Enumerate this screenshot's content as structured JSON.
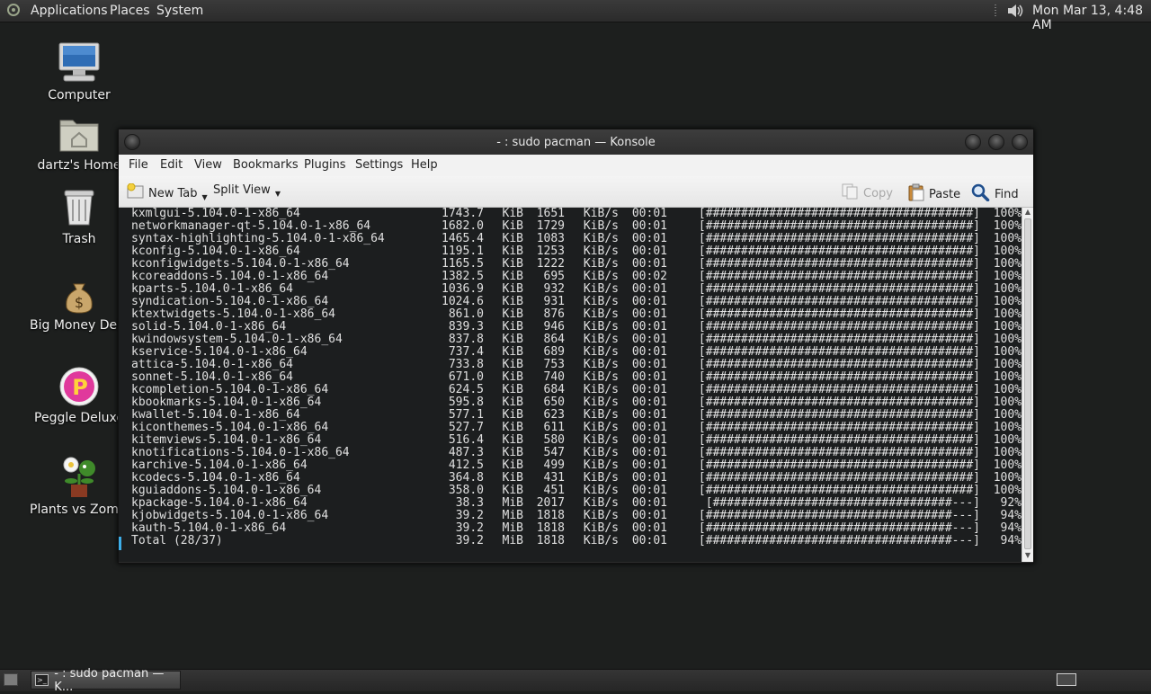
{
  "top_panel": {
    "menus": [
      "Applications",
      "Places",
      "System"
    ],
    "clock": "Mon Mar 13,  4:48 AM"
  },
  "desktop_icons": [
    {
      "label": "Computer",
      "icon": "computer-icon"
    },
    {
      "label": "dartz's Home",
      "icon": "home-folder-icon"
    },
    {
      "label": "Trash",
      "icon": "trash-icon"
    },
    {
      "label": "Big Money Delux",
      "icon": "money-bag-icon"
    },
    {
      "label": "Peggle Deluxe",
      "icon": "peggle-icon"
    },
    {
      "label": "Plants vs Zombi",
      "icon": "plants-vs-zombies-icon"
    }
  ],
  "window": {
    "title": "- : sudo pacman — Konsole",
    "menu": [
      "File",
      "Edit",
      "View",
      "Bookmarks",
      "Plugins",
      "Settings",
      "Help"
    ],
    "toolbar": {
      "new_tab": "New Tab",
      "split_view": "Split View",
      "copy": "Copy",
      "paste": "Paste",
      "find": "Find"
    }
  },
  "terminal": {
    "lines": [
      {
        "name": "kxmlgui-5.104.0-1-x86_64",
        "size": "1743.7",
        "unit": "KiB",
        "rate": "1651",
        "rate_unit": "KiB/s",
        "time": "00:01",
        "bar": "[######################################]",
        "pct": "100%"
      },
      {
        "name": "networkmanager-qt-5.104.0-1-x86_64",
        "size": "1682.0",
        "unit": "KiB",
        "rate": "1729",
        "rate_unit": "KiB/s",
        "time": "00:01",
        "bar": "[######################################]",
        "pct": "100%"
      },
      {
        "name": "syntax-highlighting-5.104.0-1-x86_64",
        "size": "1465.4",
        "unit": "KiB",
        "rate": "1083",
        "rate_unit": "KiB/s",
        "time": "00:01",
        "bar": "[######################################]",
        "pct": "100%"
      },
      {
        "name": "kconfig-5.104.0-1-x86_64",
        "size": "1195.1",
        "unit": "KiB",
        "rate": "1253",
        "rate_unit": "KiB/s",
        "time": "00:01",
        "bar": "[######################################]",
        "pct": "100%"
      },
      {
        "name": "kconfigwidgets-5.104.0-1-x86_64",
        "size": "1165.5",
        "unit": "KiB",
        "rate": "1222",
        "rate_unit": "KiB/s",
        "time": "00:01",
        "bar": "[######################################]",
        "pct": "100%"
      },
      {
        "name": "kcoreaddons-5.104.0-1-x86_64",
        "size": "1382.5",
        "unit": "KiB",
        "rate": "695",
        "rate_unit": "KiB/s",
        "time": "00:02",
        "bar": "[######################################]",
        "pct": "100%"
      },
      {
        "name": "kparts-5.104.0-1-x86_64",
        "size": "1036.9",
        "unit": "KiB",
        "rate": "932",
        "rate_unit": "KiB/s",
        "time": "00:01",
        "bar": "[######################################]",
        "pct": "100%"
      },
      {
        "name": "syndication-5.104.0-1-x86_64",
        "size": "1024.6",
        "unit": "KiB",
        "rate": "931",
        "rate_unit": "KiB/s",
        "time": "00:01",
        "bar": "[######################################]",
        "pct": "100%"
      },
      {
        "name": "ktextwidgets-5.104.0-1-x86_64",
        "size": "861.0",
        "unit": "KiB",
        "rate": "876",
        "rate_unit": "KiB/s",
        "time": "00:01",
        "bar": "[######################################]",
        "pct": "100%"
      },
      {
        "name": "solid-5.104.0-1-x86_64",
        "size": "839.3",
        "unit": "KiB",
        "rate": "946",
        "rate_unit": "KiB/s",
        "time": "00:01",
        "bar": "[######################################]",
        "pct": "100%"
      },
      {
        "name": "kwindowsystem-5.104.0-1-x86_64",
        "size": "837.8",
        "unit": "KiB",
        "rate": "864",
        "rate_unit": "KiB/s",
        "time": "00:01",
        "bar": "[######################################]",
        "pct": "100%"
      },
      {
        "name": "kservice-5.104.0-1-x86_64",
        "size": "737.4",
        "unit": "KiB",
        "rate": "689",
        "rate_unit": "KiB/s",
        "time": "00:01",
        "bar": "[######################################]",
        "pct": "100%"
      },
      {
        "name": "attica-5.104.0-1-x86_64",
        "size": "733.8",
        "unit": "KiB",
        "rate": "753",
        "rate_unit": "KiB/s",
        "time": "00:01",
        "bar": "[######################################]",
        "pct": "100%"
      },
      {
        "name": "sonnet-5.104.0-1-x86_64",
        "size": "671.0",
        "unit": "KiB",
        "rate": "740",
        "rate_unit": "KiB/s",
        "time": "00:01",
        "bar": "[######################################]",
        "pct": "100%"
      },
      {
        "name": "kcompletion-5.104.0-1-x86_64",
        "size": "624.5",
        "unit": "KiB",
        "rate": "684",
        "rate_unit": "KiB/s",
        "time": "00:01",
        "bar": "[######################################]",
        "pct": "100%"
      },
      {
        "name": "kbookmarks-5.104.0-1-x86_64",
        "size": "595.8",
        "unit": "KiB",
        "rate": "650",
        "rate_unit": "KiB/s",
        "time": "00:01",
        "bar": "[######################################]",
        "pct": "100%"
      },
      {
        "name": "kwallet-5.104.0-1-x86_64",
        "size": "577.1",
        "unit": "KiB",
        "rate": "623",
        "rate_unit": "KiB/s",
        "time": "00:01",
        "bar": "[######################################]",
        "pct": "100%"
      },
      {
        "name": "kiconthemes-5.104.0-1-x86_64",
        "size": "527.7",
        "unit": "KiB",
        "rate": "611",
        "rate_unit": "KiB/s",
        "time": "00:01",
        "bar": "[######################################]",
        "pct": "100%"
      },
      {
        "name": "kitemviews-5.104.0-1-x86_64",
        "size": "516.4",
        "unit": "KiB",
        "rate": "580",
        "rate_unit": "KiB/s",
        "time": "00:01",
        "bar": "[######################################]",
        "pct": "100%"
      },
      {
        "name": "knotifications-5.104.0-1-x86_64",
        "size": "487.3",
        "unit": "KiB",
        "rate": "547",
        "rate_unit": "KiB/s",
        "time": "00:01",
        "bar": "[######################################]",
        "pct": "100%"
      },
      {
        "name": "karchive-5.104.0-1-x86_64",
        "size": "412.5",
        "unit": "KiB",
        "rate": "499",
        "rate_unit": "KiB/s",
        "time": "00:01",
        "bar": "[######################################]",
        "pct": "100%"
      },
      {
        "name": "kcodecs-5.104.0-1-x86_64",
        "size": "364.8",
        "unit": "KiB",
        "rate": "431",
        "rate_unit": "KiB/s",
        "time": "00:01",
        "bar": "[######################################]",
        "pct": "100%"
      },
      {
        "name": "kguiaddons-5.104.0-1-x86_64",
        "size": "358.0",
        "unit": "KiB",
        "rate": "451",
        "rate_unit": "KiB/s",
        "time": "00:01",
        "bar": "[######################################]",
        "pct": "100%"
      },
      {
        "name": "kpackage-5.104.0-1-x86_64",
        "size": "38.3",
        "unit": "MiB",
        "rate": "2017",
        "rate_unit": "KiB/s",
        "time": "00:01",
        "bar": "[##################################---]",
        "pct": "92%"
      },
      {
        "name": "kjobwidgets-5.104.0-1-x86_64",
        "size": "39.2",
        "unit": "MiB",
        "rate": "1818",
        "rate_unit": "KiB/s",
        "time": "00:01",
        "bar": "[###################################---]",
        "pct": "94%"
      },
      {
        "name": "kauth-5.104.0-1-x86_64",
        "size": "39.2",
        "unit": "MiB",
        "rate": "1818",
        "rate_unit": "KiB/s",
        "time": "00:01",
        "bar": "[###################################---]",
        "pct": "94%"
      },
      {
        "name": "Total (28/37)",
        "size": "39.2",
        "unit": "MiB",
        "rate": "1818",
        "rate_unit": "KiB/s",
        "time": "00:01",
        "bar": "[###################################---]",
        "pct": "94%"
      }
    ]
  },
  "taskbar": {
    "task_label": "- : sudo pacman — K..."
  },
  "colors": {
    "desktop_bg": "#1d1f1e",
    "terminal_bg": "#1c1e1f",
    "terminal_fg": "#e0e0e0",
    "accent": "#3daee9"
  }
}
